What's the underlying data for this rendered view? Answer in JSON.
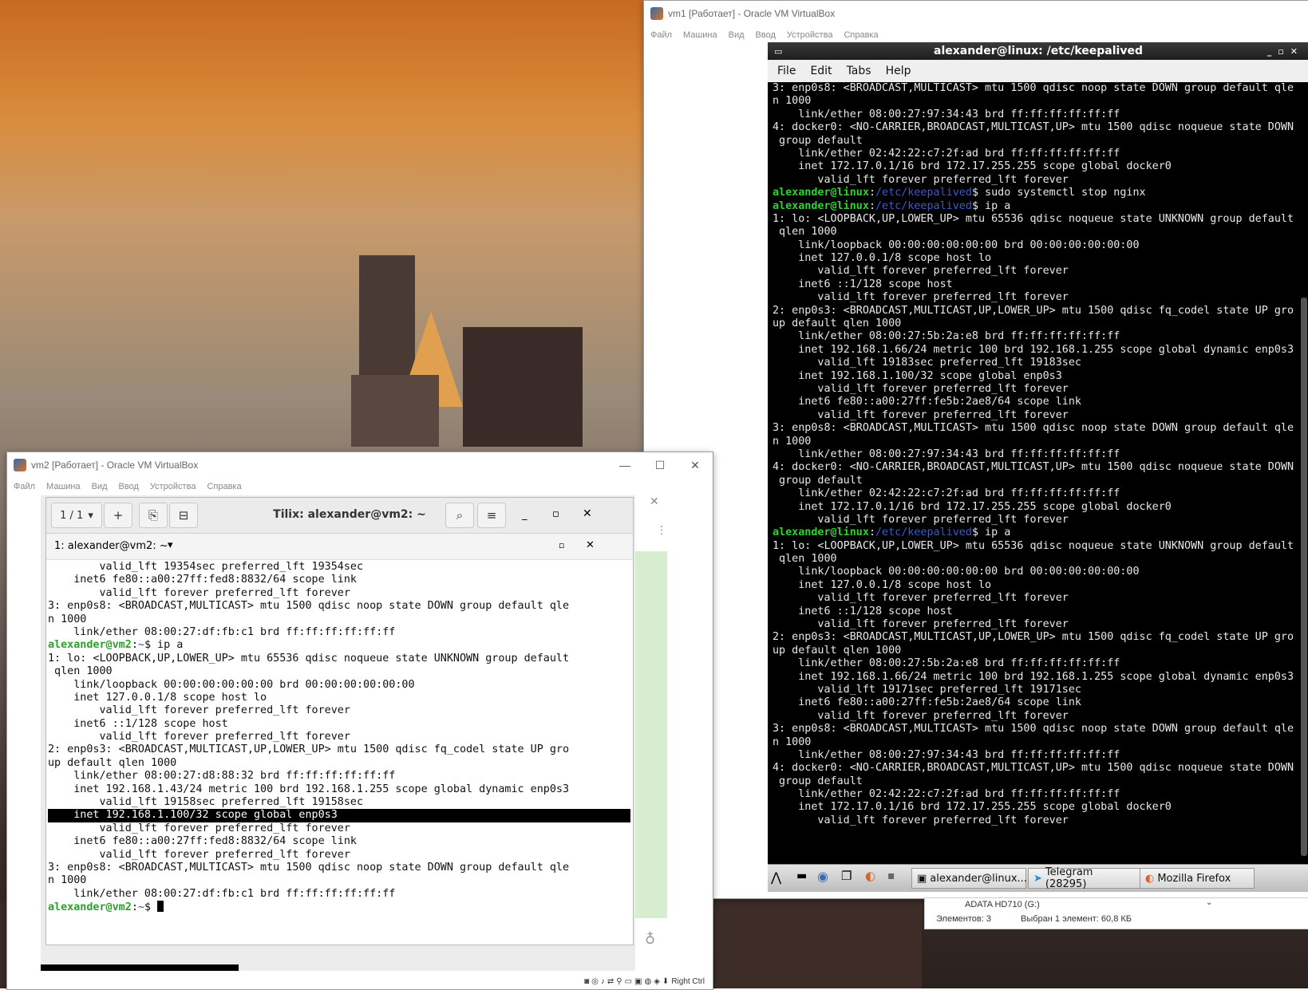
{
  "vm1": {
    "window_title": "vm1 [Работает] - Oracle VM VirtualBox",
    "menu": [
      "Файл",
      "Машина",
      "Вид",
      "Ввод",
      "Устройства",
      "Справка"
    ],
    "terminal_title": "alexander@linux: /etc/keepalived",
    "terminal_menu": [
      "File",
      "Edit",
      "Tabs",
      "Help"
    ],
    "prompt_user": "alexander@linux",
    "prompt_path": "/etc/keepalived",
    "lines": [
      {
        "t": "3: enp0s8: <BROADCAST,MULTICAST> mtu 1500 qdisc noop state DOWN group default qle"
      },
      {
        "t": "n 1000"
      },
      {
        "t": "    link/ether 08:00:27:97:34:43 brd ff:ff:ff:ff:ff:ff"
      },
      {
        "t": "4: docker0: <NO-CARRIER,BROADCAST,MULTICAST,UP> mtu 1500 qdisc noqueue state DOWN"
      },
      {
        "t": " group default"
      },
      {
        "t": "    link/ether 02:42:22:c7:2f:ad brd ff:ff:ff:ff:ff:ff"
      },
      {
        "t": "    inet 172.17.0.1/16 brd 172.17.255.255 scope global docker0"
      },
      {
        "t": "       valid_lft forever preferred_lft forever"
      },
      {
        "prompt": true,
        "t": "$ sudo systemctl stop nginx"
      },
      {
        "prompt": true,
        "t": "$ ip a"
      },
      {
        "t": "1: lo: <LOOPBACK,UP,LOWER_UP> mtu 65536 qdisc noqueue state UNKNOWN group default"
      },
      {
        "t": " qlen 1000"
      },
      {
        "t": "    link/loopback 00:00:00:00:00:00 brd 00:00:00:00:00:00"
      },
      {
        "t": "    inet 127.0.0.1/8 scope host lo"
      },
      {
        "t": "       valid_lft forever preferred_lft forever"
      },
      {
        "t": "    inet6 ::1/128 scope host"
      },
      {
        "t": "       valid_lft forever preferred_lft forever"
      },
      {
        "t": "2: enp0s3: <BROADCAST,MULTICAST,UP,LOWER_UP> mtu 1500 qdisc fq_codel state UP gro"
      },
      {
        "t": "up default qlen 1000"
      },
      {
        "t": "    link/ether 08:00:27:5b:2a:e8 brd ff:ff:ff:ff:ff:ff"
      },
      {
        "t": "    inet 192.168.1.66/24 metric 100 brd 192.168.1.255 scope global dynamic enp0s3"
      },
      {
        "t": "       valid_lft 19183sec preferred_lft 19183sec"
      },
      {
        "t": "    inet 192.168.1.100/32 scope global enp0s3"
      },
      {
        "t": "       valid_lft forever preferred_lft forever"
      },
      {
        "t": "    inet6 fe80::a00:27ff:fe5b:2ae8/64 scope link"
      },
      {
        "t": "       valid_lft forever preferred_lft forever"
      },
      {
        "t": "3: enp0s8: <BROADCAST,MULTICAST> mtu 1500 qdisc noop state DOWN group default qle"
      },
      {
        "t": "n 1000"
      },
      {
        "t": "    link/ether 08:00:27:97:34:43 brd ff:ff:ff:ff:ff:ff"
      },
      {
        "t": "4: docker0: <NO-CARRIER,BROADCAST,MULTICAST,UP> mtu 1500 qdisc noqueue state DOWN"
      },
      {
        "t": " group default"
      },
      {
        "t": "    link/ether 02:42:22:c7:2f:ad brd ff:ff:ff:ff:ff:ff"
      },
      {
        "t": "    inet 172.17.0.1/16 brd 172.17.255.255 scope global docker0"
      },
      {
        "t": "       valid_lft forever preferred_lft forever"
      },
      {
        "prompt": true,
        "t": "$ ip a"
      },
      {
        "t": "1: lo: <LOOPBACK,UP,LOWER_UP> mtu 65536 qdisc noqueue state UNKNOWN group default"
      },
      {
        "t": " qlen 1000"
      },
      {
        "t": "    link/loopback 00:00:00:00:00:00 brd 00:00:00:00:00:00"
      },
      {
        "t": "    inet 127.0.0.1/8 scope host lo"
      },
      {
        "t": "       valid_lft forever preferred_lft forever"
      },
      {
        "t": "    inet6 ::1/128 scope host"
      },
      {
        "t": "       valid_lft forever preferred_lft forever"
      },
      {
        "t": "2: enp0s3: <BROADCAST,MULTICAST,UP,LOWER_UP> mtu 1500 qdisc fq_codel state UP gro"
      },
      {
        "t": "up default qlen 1000"
      },
      {
        "t": "    link/ether 08:00:27:5b:2a:e8 brd ff:ff:ff:ff:ff:ff"
      },
      {
        "t": "    inet 192.168.1.66/24 metric 100 brd 192.168.1.255 scope global dynamic enp0s3"
      },
      {
        "t": "       valid_lft 19171sec preferred_lft 19171sec"
      },
      {
        "t": "    inet6 fe80::a00:27ff:fe5b:2ae8/64 scope link"
      },
      {
        "t": "       valid_lft forever preferred_lft forever"
      },
      {
        "t": "3: enp0s8: <BROADCAST,MULTICAST> mtu 1500 qdisc noop state DOWN group default qle"
      },
      {
        "t": "n 1000"
      },
      {
        "t": "    link/ether 08:00:27:97:34:43 brd ff:ff:ff:ff:ff:ff"
      },
      {
        "t": "4: docker0: <NO-CARRIER,BROADCAST,MULTICAST,UP> mtu 1500 qdisc noqueue state DOWN"
      },
      {
        "t": " group default"
      },
      {
        "t": "    link/ether 02:42:22:c7:2f:ad brd ff:ff:ff:ff:ff:ff"
      },
      {
        "t": "    inet 172.17.0.1/16 brd 172.17.255.255 scope global docker0"
      },
      {
        "t": "       valid_lft forever preferred_lft forever"
      }
    ],
    "taskbar": {
      "items": [
        "alexander@linux...",
        "Telegram (28295)",
        "Mozilla Firefox"
      ]
    }
  },
  "vm2": {
    "window_title": "vm2 [Работает] - Oracle VM VirtualBox",
    "menu": [
      "Файл",
      "Машина",
      "Вид",
      "Ввод",
      "Устройства",
      "Справка"
    ],
    "tilix_title": "Tilix: alexander@vm2: ~",
    "tab_counter": "1 / 1",
    "session_label": "1: alexander@vm2: ~",
    "prompt_user": "alexander@vm2",
    "prompt_path": "~",
    "status_right": "Right Ctrl",
    "lines": [
      {
        "t": "        valid_lft 19354sec preferred_lft 19354sec"
      },
      {
        "t": "    inet6 fe80::a00:27ff:fed8:8832/64 scope link"
      },
      {
        "t": "        valid_lft forever preferred_lft forever"
      },
      {
        "t": "3: enp0s8: <BROADCAST,MULTICAST> mtu 1500 qdisc noop state DOWN group default qle"
      },
      {
        "t": "n 1000"
      },
      {
        "t": "    link/ether 08:00:27:df:fb:c1 brd ff:ff:ff:ff:ff:ff"
      },
      {
        "prompt": true,
        "t": "$ ip a"
      },
      {
        "t": "1: lo: <LOOPBACK,UP,LOWER_UP> mtu 65536 qdisc noqueue state UNKNOWN group default"
      },
      {
        "t": " qlen 1000"
      },
      {
        "t": "    link/loopback 00:00:00:00:00:00 brd 00:00:00:00:00:00"
      },
      {
        "t": "    inet 127.0.0.1/8 scope host lo"
      },
      {
        "t": "        valid_lft forever preferred_lft forever"
      },
      {
        "t": "    inet6 ::1/128 scope host"
      },
      {
        "t": "        valid_lft forever preferred_lft forever"
      },
      {
        "t": "2: enp0s3: <BROADCAST,MULTICAST,UP,LOWER_UP> mtu 1500 qdisc fq_codel state UP gro"
      },
      {
        "t": "up default qlen 1000"
      },
      {
        "t": "    link/ether 08:00:27:d8:88:32 brd ff:ff:ff:ff:ff:ff"
      },
      {
        "t": "    inet 192.168.1.43/24 metric 100 brd 192.168.1.255 scope global dynamic enp0s3"
      },
      {
        "t": "        valid_lft 19158sec preferred_lft 19158sec"
      },
      {
        "hl": true,
        "t": "    inet 192.168.1.100/32 scope global enp0s3"
      },
      {
        "t": "        valid_lft forever preferred_lft forever"
      },
      {
        "t": "    inet6 fe80::a00:27ff:fed8:8832/64 scope link"
      },
      {
        "t": "        valid_lft forever preferred_lft forever"
      },
      {
        "t": "3: enp0s8: <BROADCAST,MULTICAST> mtu 1500 qdisc noop state DOWN group default qle"
      },
      {
        "t": "n 1000"
      },
      {
        "t": "    link/ether 08:00:27:df:fb:c1 brd ff:ff:ff:ff:ff:ff"
      },
      {
        "prompt": true,
        "cursor": true,
        "t": "$ "
      }
    ]
  },
  "explorer": {
    "drive_label": "ADATA HD710 (G:)",
    "items_count": "Элементов: 3",
    "selected": "Выбран 1 элемент: 60,8 КБ"
  }
}
